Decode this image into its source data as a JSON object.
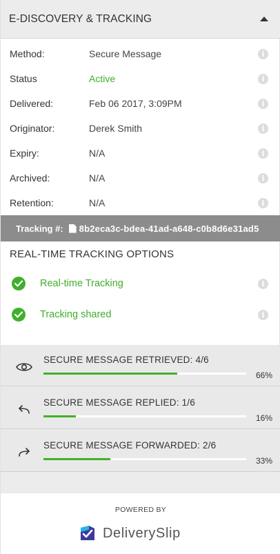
{
  "panel": {
    "title": "E-DISCOVERY & TRACKING"
  },
  "details": [
    {
      "label": "Method:",
      "value": "Secure Message"
    },
    {
      "label": "Status",
      "value": "Active"
    },
    {
      "label": "Delivered:",
      "value": "Feb 06 2017, 3:09PM"
    },
    {
      "label": "Originator:",
      "value": "Derek Smith"
    },
    {
      "label": "Expiry:",
      "value": "N/A"
    },
    {
      "label": "Archived:",
      "value": "N/A"
    },
    {
      "label": "Retention:",
      "value": "N/A"
    }
  ],
  "tracking": {
    "label": "Tracking #:",
    "id": "8b2eca3c-bdea-41ad-a648-c0b8d6e31ad5"
  },
  "realtime": {
    "title": "REAL-TIME TRACKING OPTIONS",
    "options": [
      {
        "label": "Real-time Tracking"
      },
      {
        "label": "Tracking shared"
      }
    ]
  },
  "stats": [
    {
      "label": "SECURE MESSAGE RETRIEVED: 4/6",
      "percent_text": "66%",
      "progress": 0.66,
      "icon": "eye-icon"
    },
    {
      "label": "SECURE MESSAGE REPLIED: 1/6",
      "percent_text": "16%",
      "progress": 0.16,
      "icon": "reply-arrow-icon"
    },
    {
      "label": "SECURE MESSAGE FORWARDED: 2/6",
      "percent_text": "33%",
      "progress": 0.33,
      "icon": "forward-arrow-icon"
    }
  ],
  "footer": {
    "powered_by": "POWERED BY",
    "brand": "DeliverySlip"
  },
  "colors": {
    "accent_green": "#3fb02b",
    "header_bg": "#ececec",
    "tracking_bar_bg": "#8c8c8c"
  }
}
